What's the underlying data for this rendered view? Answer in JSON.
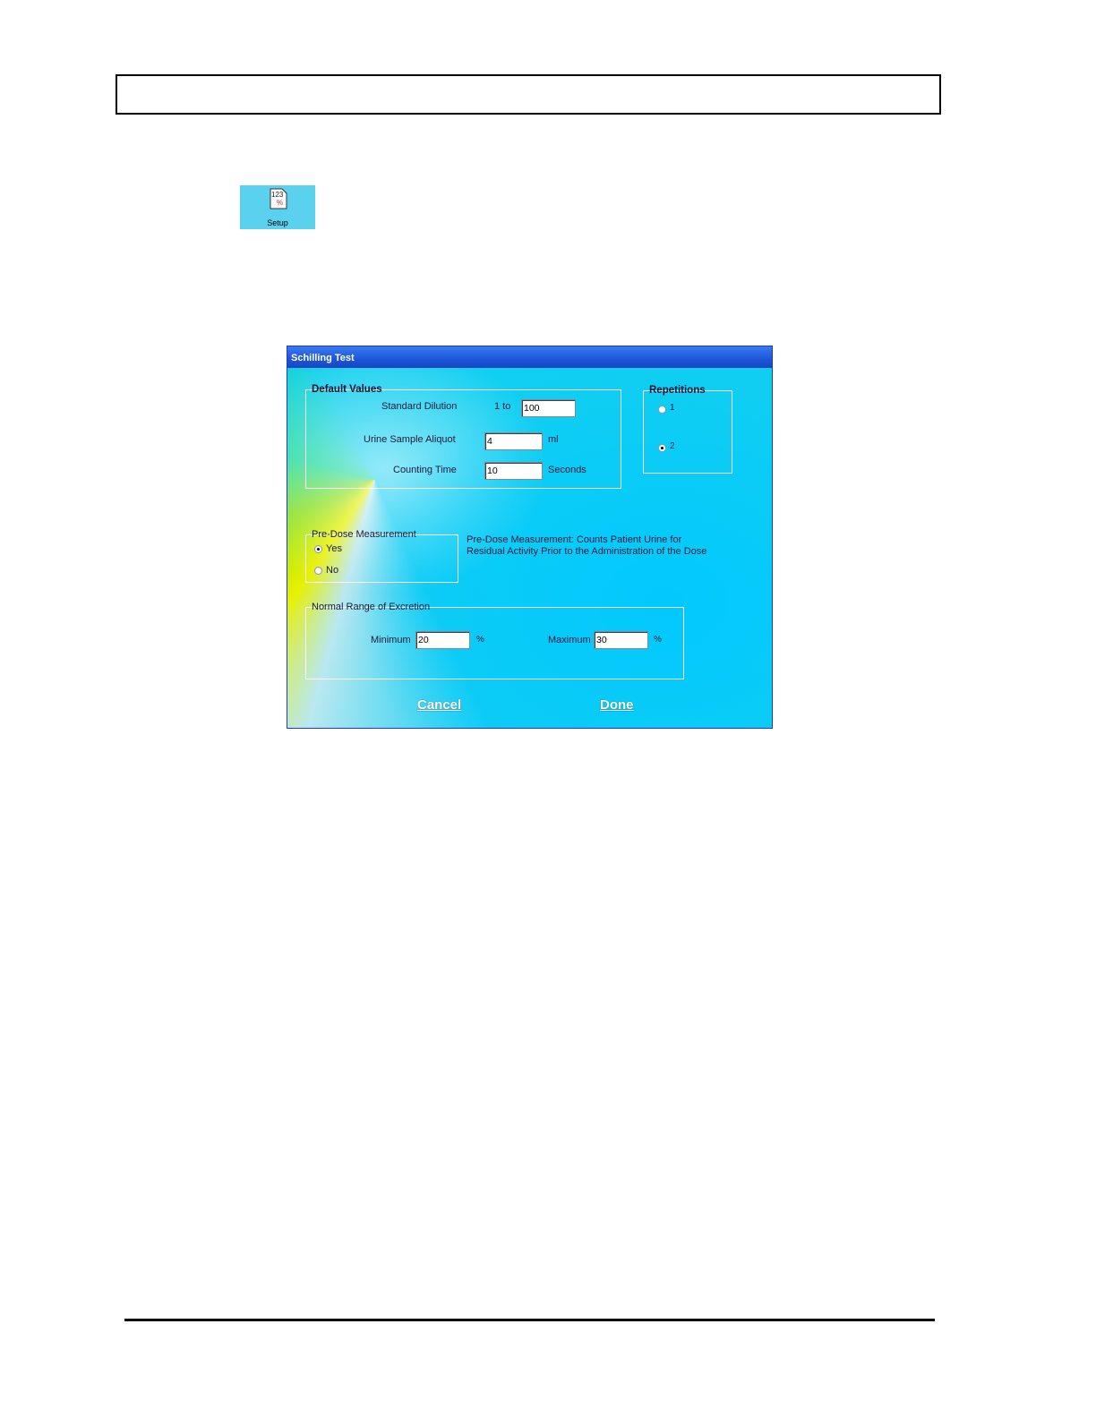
{
  "setup_tile": {
    "icon_text": "123",
    "label": "Setup"
  },
  "window": {
    "title": "Schilling Test",
    "default_values": {
      "group_label": "Default Values",
      "standard_dilution_label": "Standard Dilution",
      "standard_dilution_prefix": "1 to",
      "standard_dilution_value": "100",
      "urine_aliquot_label": "Urine Sample Aliquot",
      "urine_aliquot_value": "4",
      "urine_aliquot_unit": "ml",
      "counting_time_label": "Counting Time",
      "counting_time_value": "10",
      "counting_time_unit": "Seconds"
    },
    "repetitions": {
      "group_label": "Repetitions",
      "options": [
        {
          "label": "1",
          "checked": false
        },
        {
          "label": "2",
          "checked": true
        }
      ]
    },
    "pre_dose": {
      "group_label": "Pre-Dose Measurement",
      "options": [
        {
          "label": "Yes",
          "checked": true
        },
        {
          "label": "No",
          "checked": false
        }
      ],
      "description_line1": "Pre-Dose Measurement: Counts Patient Urine for",
      "description_line2": "Residual Activity  Prior to the Administration of the Dose"
    },
    "normal_range": {
      "group_label": "Normal Range of Excretion",
      "minimum_label": "Minimum",
      "minimum_value": "20",
      "maximum_label": "Maximum",
      "maximum_value": "30",
      "unit": "%"
    },
    "buttons": {
      "cancel": "Cancel",
      "done": "Done"
    }
  }
}
